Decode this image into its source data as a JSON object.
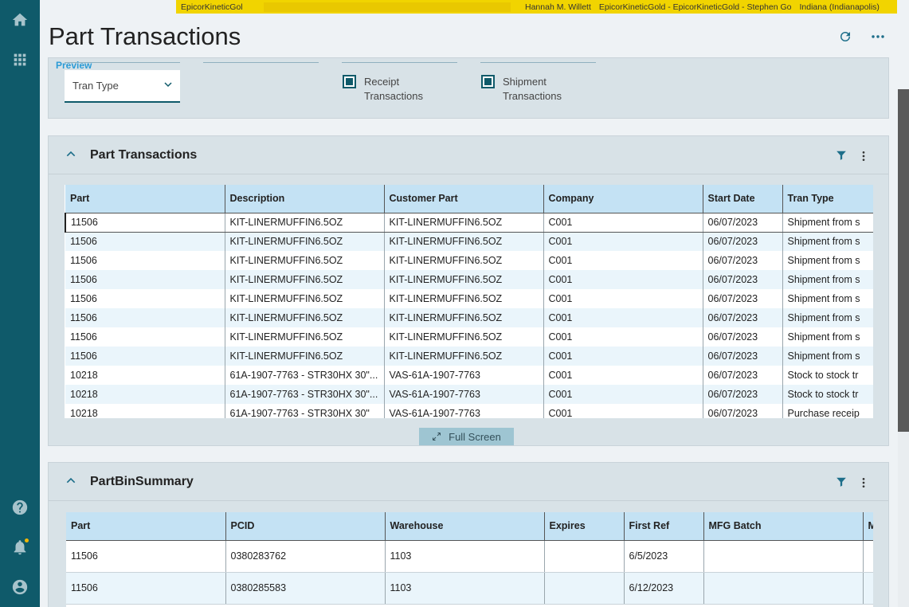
{
  "topbar": {
    "app": "EpicorKineticGol",
    "user": "Hannah M. Willett",
    "company": "EpicorKineticGold - EpicorKineticGold - Stephen Go",
    "site": "Indiana (Indianapolis)"
  },
  "page": {
    "title": "Part Transactions"
  },
  "filters": {
    "preview_label": "Preview",
    "tran_type_label": "Tran Type",
    "receipt_label": "Receipt Transactions",
    "shipment_label": "Shipment Transactions"
  },
  "part_transactions": {
    "title": "Part Transactions",
    "full_screen_label": "Full Screen",
    "columns": [
      "Part",
      "Description",
      "Customer Part",
      "Company",
      "Start Date",
      "Tran Type"
    ],
    "rows": [
      [
        "11506",
        "KIT-LINERMUFFIN6.5OZ",
        "KIT-LINERMUFFIN6.5OZ",
        "C001",
        "06/07/2023",
        "Shipment from s"
      ],
      [
        "11506",
        "KIT-LINERMUFFIN6.5OZ",
        "KIT-LINERMUFFIN6.5OZ",
        "C001",
        "06/07/2023",
        "Shipment from s"
      ],
      [
        "11506",
        "KIT-LINERMUFFIN6.5OZ",
        "KIT-LINERMUFFIN6.5OZ",
        "C001",
        "06/07/2023",
        "Shipment from s"
      ],
      [
        "11506",
        "KIT-LINERMUFFIN6.5OZ",
        "KIT-LINERMUFFIN6.5OZ",
        "C001",
        "06/07/2023",
        "Shipment from s"
      ],
      [
        "11506",
        "KIT-LINERMUFFIN6.5OZ",
        "KIT-LINERMUFFIN6.5OZ",
        "C001",
        "06/07/2023",
        "Shipment from s"
      ],
      [
        "11506",
        "KIT-LINERMUFFIN6.5OZ",
        "KIT-LINERMUFFIN6.5OZ",
        "C001",
        "06/07/2023",
        "Shipment from s"
      ],
      [
        "11506",
        "KIT-LINERMUFFIN6.5OZ",
        "KIT-LINERMUFFIN6.5OZ",
        "C001",
        "06/07/2023",
        "Shipment from s"
      ],
      [
        "11506",
        "KIT-LINERMUFFIN6.5OZ",
        "KIT-LINERMUFFIN6.5OZ",
        "C001",
        "06/07/2023",
        "Shipment from s"
      ],
      [
        "10218",
        "61A-1907-7763 - STR30HX 30\"...",
        "VAS-61A-1907-7763",
        "C001",
        "06/07/2023",
        "Stock to stock tr"
      ],
      [
        "10218",
        "61A-1907-7763 - STR30HX 30\"...",
        "VAS-61A-1907-7763",
        "C001",
        "06/07/2023",
        "Stock to stock tr"
      ],
      [
        "10218",
        "61A-1907-7763 - STR30HX 30\"",
        "VAS-61A-1907-7763",
        "C001",
        "06/07/2023",
        "Purchase receip"
      ]
    ]
  },
  "part_bin_summary": {
    "title": "PartBinSummary",
    "columns": [
      "Part",
      "PCID",
      "Warehouse",
      "Expires",
      "First Ref",
      "MFG Batch",
      "M"
    ],
    "rows": [
      [
        "11506",
        "0380283762",
        "1103",
        "",
        "6/5/2023",
        "",
        ""
      ],
      [
        "11506",
        "0380285583",
        "1103",
        "",
        "6/12/2023",
        "",
        ""
      ]
    ]
  }
}
